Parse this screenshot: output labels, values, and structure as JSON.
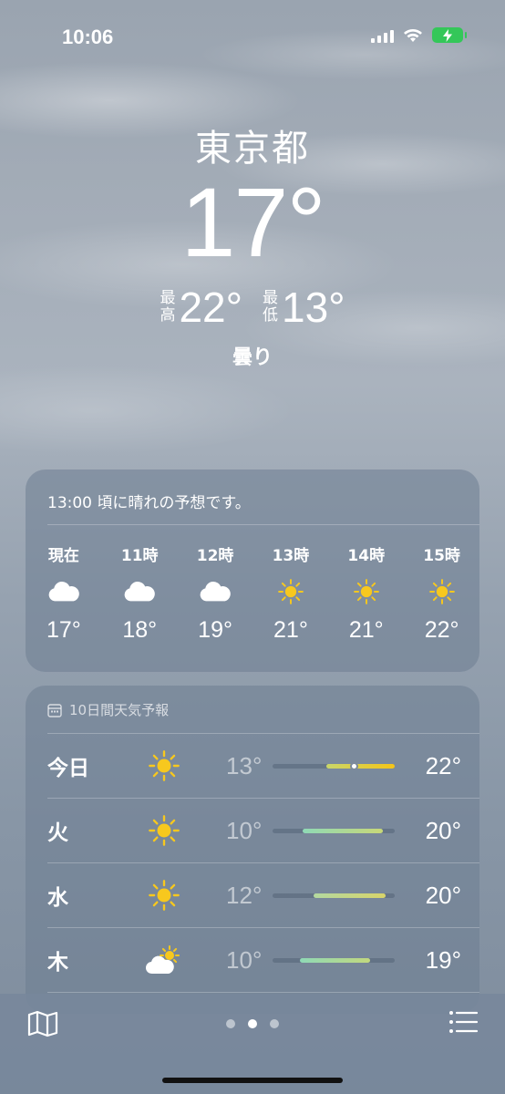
{
  "status": {
    "time": "10:06"
  },
  "location": {
    "city": "東京都",
    "temperature": "17°",
    "high_label_top": "最",
    "high_label_bottom": "高",
    "high": "22°",
    "low_label_top": "最",
    "low_label_bottom": "低",
    "low": "13°",
    "condition": "曇り"
  },
  "hourly": {
    "summary": "13:00 頃に晴れの予想です。",
    "items": [
      {
        "label": "現在",
        "icon": "cloud-icon",
        "temp": "17°"
      },
      {
        "label": "11時",
        "icon": "cloud-icon",
        "temp": "18°"
      },
      {
        "label": "12時",
        "icon": "cloud-icon",
        "temp": "19°"
      },
      {
        "label": "13時",
        "icon": "sun-icon",
        "temp": "21°"
      },
      {
        "label": "14時",
        "icon": "sun-icon",
        "temp": "21°"
      },
      {
        "label": "15時",
        "icon": "sun-icon",
        "temp": "22°"
      }
    ]
  },
  "daily": {
    "title": "10日間天気予報",
    "days": [
      {
        "name": "今日",
        "icon": "sun-icon",
        "low": "13°",
        "high": "22°",
        "bar_start": 0.44,
        "bar_end": 1.0,
        "current": 0.66,
        "color": "linear-gradient(90deg,#c9d66a,#f5c518)"
      },
      {
        "name": "火",
        "icon": "sun-icon",
        "low": "10°",
        "high": "20°",
        "bar_start": 0.24,
        "bar_end": 0.9,
        "current": null,
        "color": "linear-gradient(90deg,#8fd9b6,#c8d878)"
      },
      {
        "name": "水",
        "icon": "sun-icon",
        "low": "12°",
        "high": "20°",
        "bar_start": 0.33,
        "bar_end": 0.92,
        "current": null,
        "color": "linear-gradient(90deg,#b3d8a0,#d8d46a)"
      },
      {
        "name": "木",
        "icon": "partly-sunny-icon",
        "low": "10°",
        "high": "19°",
        "bar_start": 0.22,
        "bar_end": 0.8,
        "current": null,
        "color": "linear-gradient(90deg,#8fd9b6,#c2d87e)"
      }
    ]
  },
  "colors": {
    "sun": "#f7c81e",
    "cloud": "#ffffff"
  }
}
